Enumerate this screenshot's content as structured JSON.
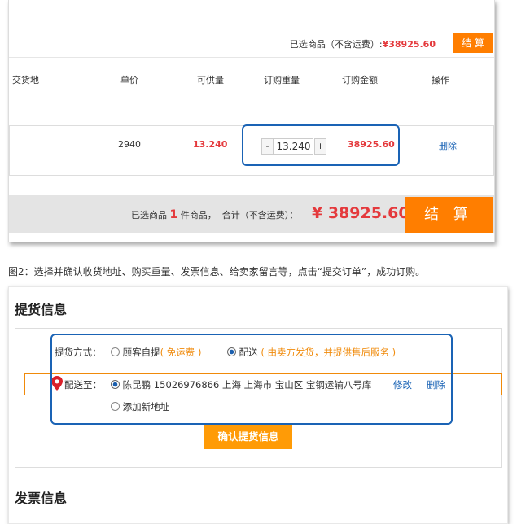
{
  "cart": {
    "selected_summary_label": "已选商品（不含运费）:",
    "selected_summary_amount": "¥38925.60",
    "checkout_small_label": "结 算",
    "columns": {
      "delivery_place": "交货地",
      "unit_price": "单价",
      "available": "可供量",
      "order_weight": "订购重量",
      "order_amount": "订购金额",
      "action": "操作"
    },
    "item": {
      "unit_price": "2940",
      "available": "13.240",
      "quantity": "13.240",
      "minus": "-",
      "plus": "+",
      "amount": "38925.60",
      "delete": "删除"
    },
    "footer": {
      "selected_prefix": "已选商品",
      "selected_count": "1",
      "selected_suffix": "件商品，",
      "total_label": "合计（不含运费）：",
      "total_amount": "¥ 38925.60",
      "checkout_label": "结 算"
    }
  },
  "caption": "图2：选择并确认收货地址、购买重量、发票信息、给卖家留言等，点击“提交订单”，成功订购。",
  "delivery": {
    "title": "提货信息",
    "method_label": "提货方式：",
    "option_pickup": "顾客自提",
    "option_pickup_note": "( 免运费 )",
    "option_ship": "配送",
    "option_ship_note": "( 由卖方发货，并提供售后服务 )",
    "ship_to_label": "配送至：",
    "address": "陈昆鹏 15026976866 上海 上海市 宝山区 宝钢运输八号库",
    "edit": "修改",
    "delete": "删除",
    "add_address": "添加新地址",
    "confirm_button": "确认提货信息",
    "invoice_title": "发票信息"
  },
  "colors": {
    "accent_orange": "#ff7e00",
    "price_red": "#e4393c",
    "link_blue": "#1a63b5",
    "highlight_blue": "#1a63b5"
  }
}
